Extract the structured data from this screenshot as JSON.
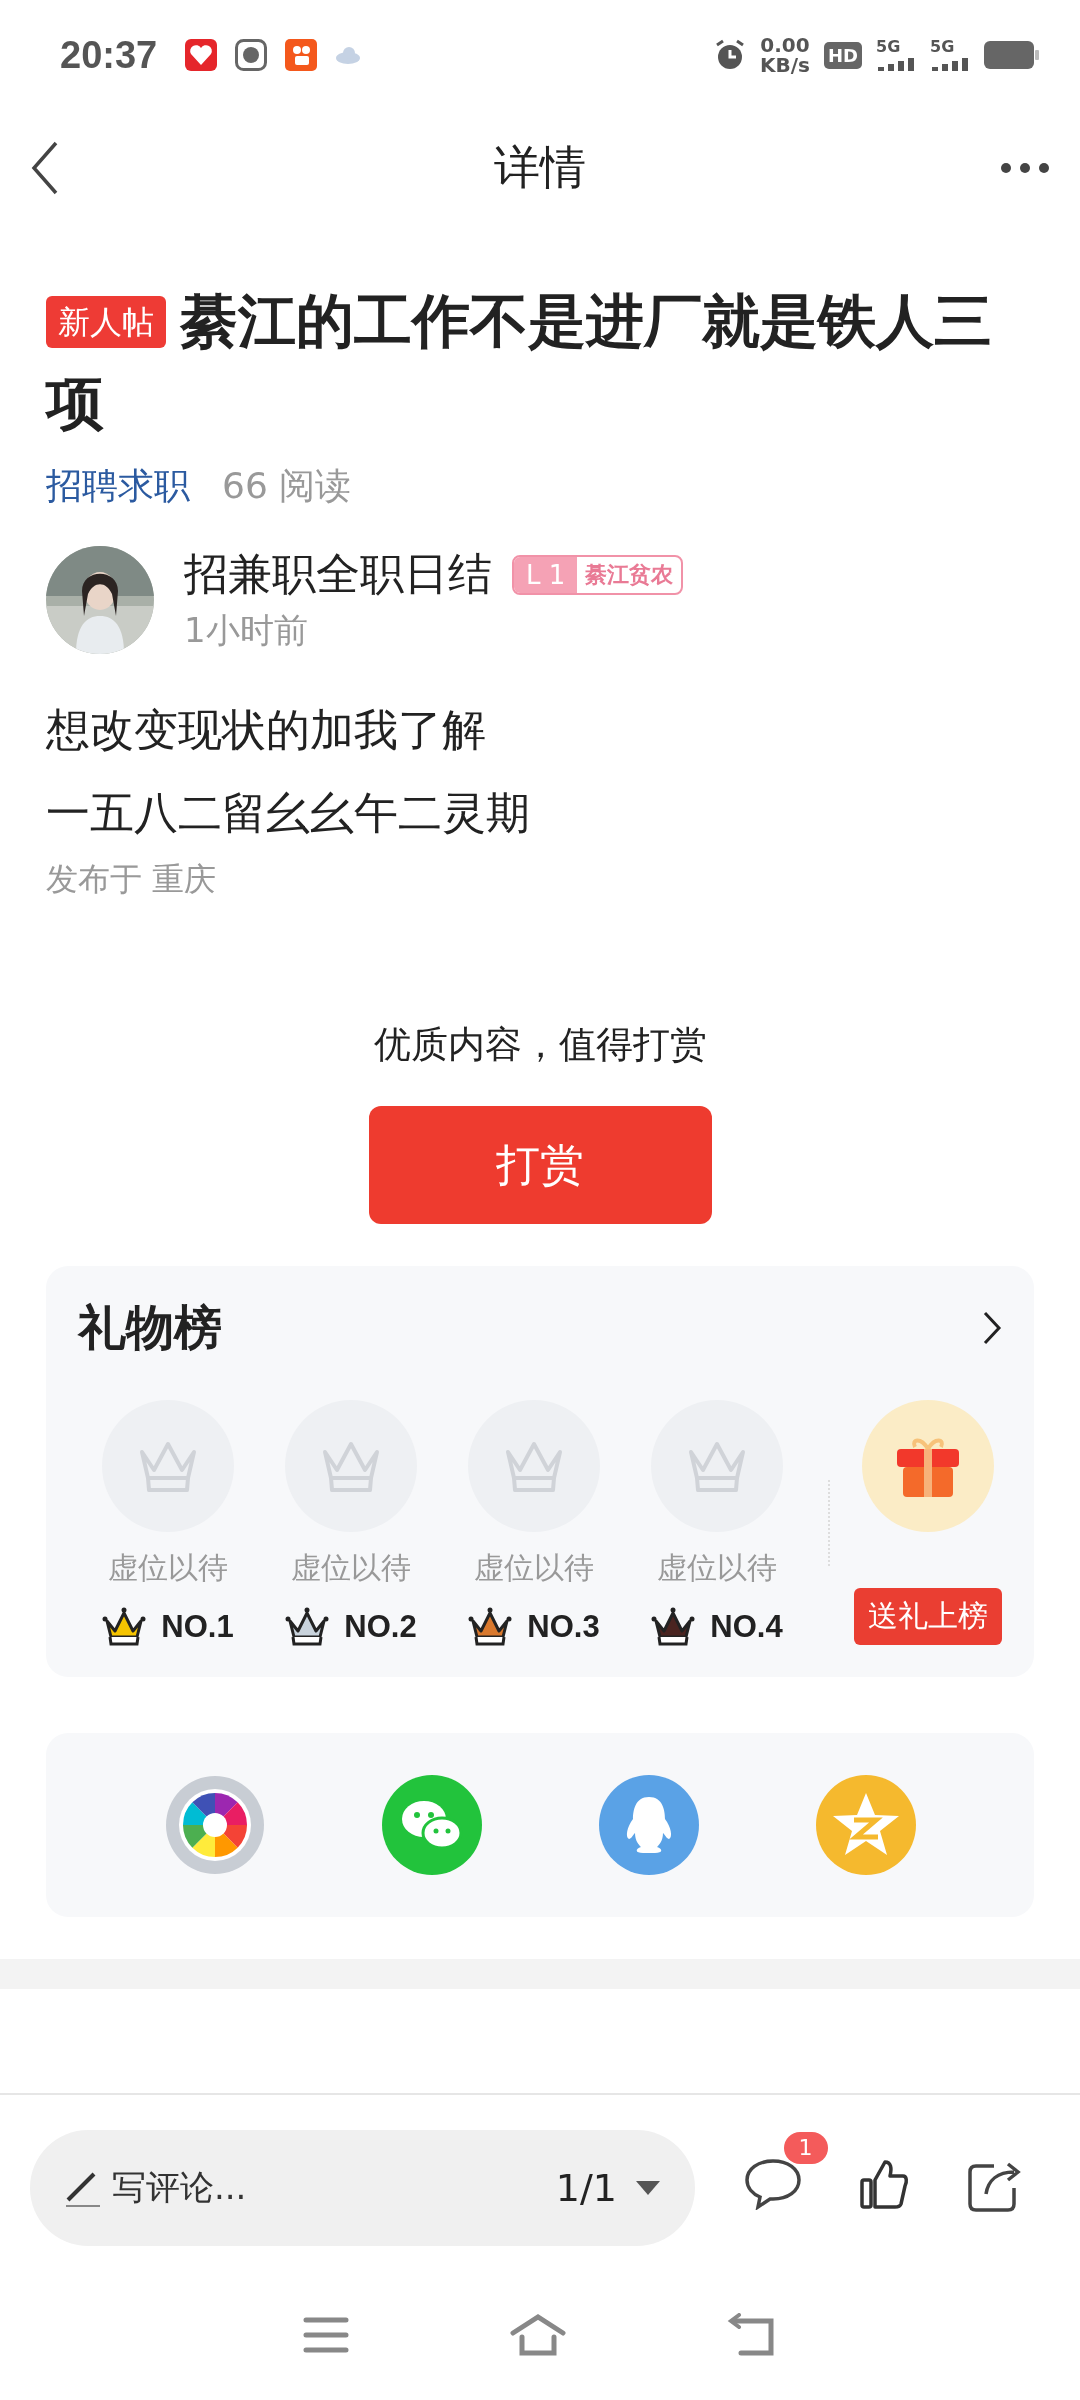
{
  "status_bar": {
    "time": "20:37",
    "net_speed": "0.00",
    "net_unit": "KB/s",
    "hd": "HD",
    "sim1": "5G",
    "sim2": "5G"
  },
  "nav": {
    "title": "详情"
  },
  "post": {
    "tag": "新人帖",
    "title": "綦江的工作不是进厂就是铁人三项",
    "category": "招聘求职",
    "reads": "66 阅读",
    "author": {
      "name": "招兼职全职日结",
      "level": "L 1",
      "badge": "綦江贫农",
      "time": "1小时前"
    },
    "body": [
      "想改变现状的加我了解",
      "一五八二留幺幺午二灵期"
    ],
    "location": "发布于 重庆"
  },
  "reward": {
    "prompt": "优质内容，值得打赏",
    "button": "打赏"
  },
  "gift_board": {
    "title": "礼物榜",
    "send_button": "送礼上榜",
    "slots": [
      {
        "label": "虚位以待",
        "rank": "NO.1",
        "color": "#f5c400"
      },
      {
        "label": "虚位以待",
        "rank": "NO.2",
        "color": "#c9d3dc"
      },
      {
        "label": "虚位以待",
        "rank": "NO.3",
        "color": "#d9792e"
      },
      {
        "label": "虚位以待",
        "rank": "NO.4",
        "color": "#4a2420"
      }
    ]
  },
  "share": [
    {
      "kind": "moments"
    },
    {
      "kind": "wechat"
    },
    {
      "kind": "qq"
    },
    {
      "kind": "qzone"
    }
  ],
  "bottom_bar": {
    "comment_placeholder": "写评论...",
    "page": "1/1",
    "comment_count": "1"
  }
}
